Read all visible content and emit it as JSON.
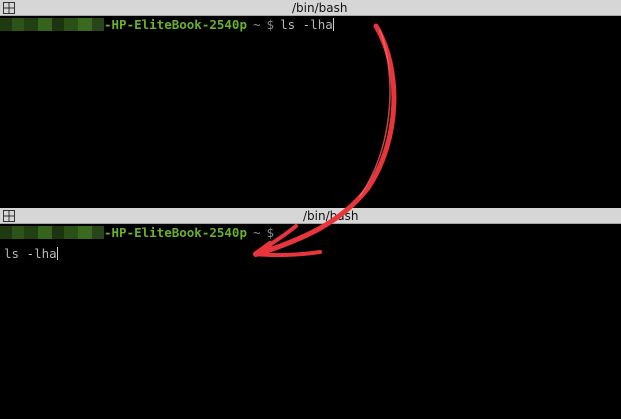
{
  "top_pane": {
    "title": "/bin/bash",
    "prompt_host": "-HP-EliteBook-2540p",
    "prompt_tilde": "~",
    "prompt_symbol": "$",
    "command": "ls -lha"
  },
  "bottom_pane": {
    "title": "/bin/bash",
    "prompt_host": "-HP-EliteBook-2540p",
    "prompt_tilde": "~",
    "prompt_symbol": "$",
    "input_text": "ls -lha"
  },
  "colors": {
    "host_green": "#6ab02e",
    "arrow_red": "#e8353c",
    "terminal_bg": "#000000",
    "titlebar_bg": "#d6d6d6"
  },
  "icons": {
    "window": "window-grid-icon"
  }
}
